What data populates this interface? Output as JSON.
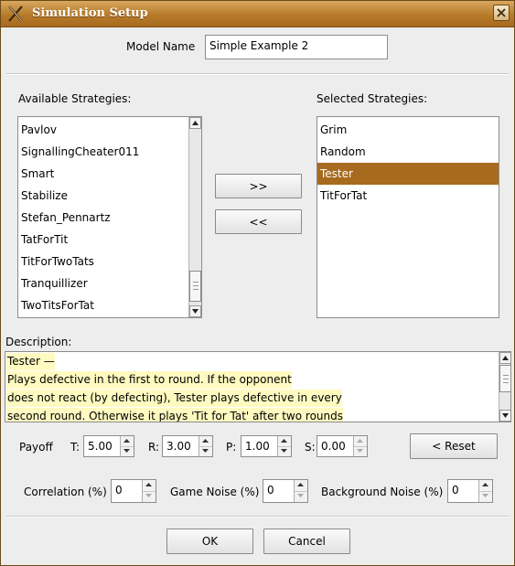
{
  "window": {
    "title": "Simulation Setup"
  },
  "model": {
    "label": "Model Name",
    "value": "Simple Example 2"
  },
  "available": {
    "label": "Available Strategies:",
    "items": [
      "Pavlov",
      "SignallingCheater011",
      "Smart",
      "Stabilize",
      "Stefan_Pennartz",
      "TatForTit",
      "TitForTwoTats",
      "Tranquillizer",
      "TwoTitsForTat"
    ]
  },
  "selected": {
    "label": "Selected Strategies:",
    "items": [
      "Grim",
      "Random",
      "Tester",
      "TitForTat"
    ],
    "selected_item": "Tester"
  },
  "buttons": {
    "add": ">>",
    "remove": "<<",
    "reset": "< Reset",
    "ok": "OK",
    "cancel": "Cancel"
  },
  "description": {
    "label": "Description:",
    "lines": [
      "Tester —",
      "Plays defective in the first to round. If the opponent",
      "does not react (by defecting), Tester plays defective in every",
      "second round. Otherwise it plays 'Tit for Tat' after two rounds"
    ]
  },
  "payoff": {
    "label": "Payoff",
    "T": {
      "label": "T:",
      "value": "5.00"
    },
    "R": {
      "label": "R:",
      "value": "3.00"
    },
    "P": {
      "label": "P:",
      "value": "1.00"
    },
    "S": {
      "label": "S:",
      "value": "0.00"
    }
  },
  "noise": {
    "correlation": {
      "label": "Correlation (%)",
      "value": "0"
    },
    "game": {
      "label": "Game Noise (%)",
      "value": "0"
    },
    "background": {
      "label": "Background Noise (%)",
      "value": "0"
    }
  },
  "colors": {
    "accent": "#a86a1e",
    "description_highlight": "#fffac0"
  },
  "icons": {
    "app": "x-logo-icon",
    "close": "close-icon"
  }
}
